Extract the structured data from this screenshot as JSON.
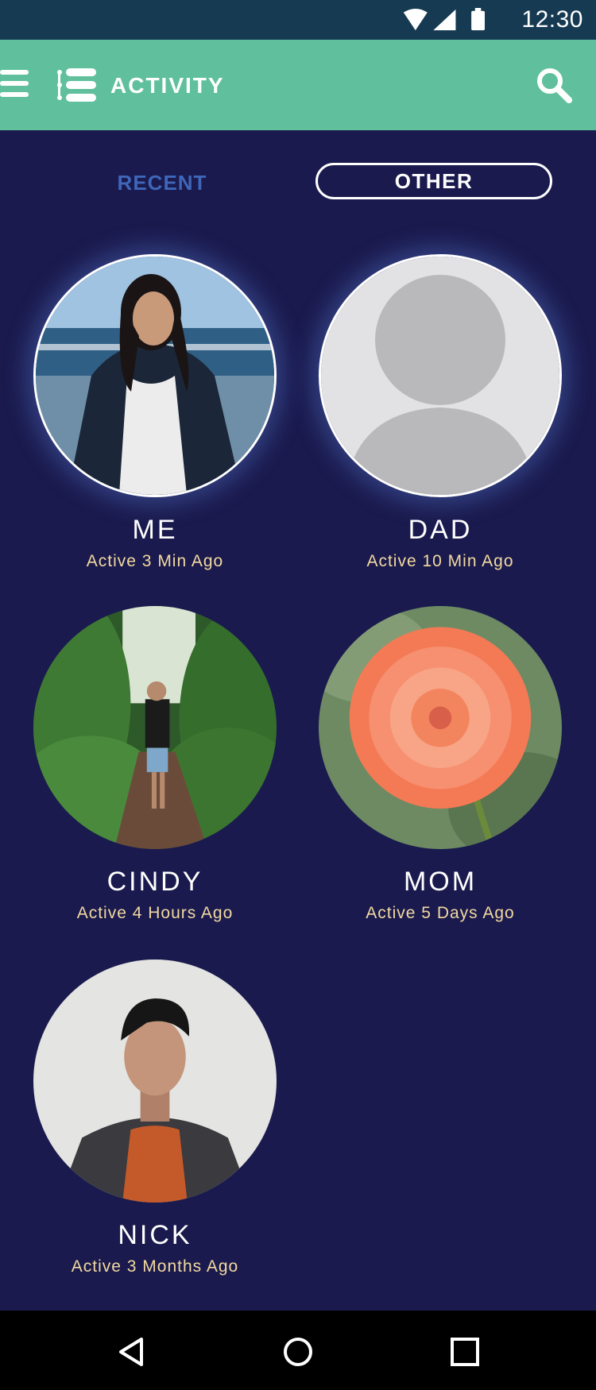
{
  "status_bar": {
    "time": "12:30",
    "icons": [
      "wifi-icon",
      "signal-icon",
      "battery-icon"
    ]
  },
  "app_bar": {
    "title": "ACTIVITY",
    "icons": [
      "menu-icon",
      "list-icon",
      "search-icon"
    ],
    "color": "#60c09d"
  },
  "tabs": [
    {
      "label": "RECENT",
      "selected": false
    },
    {
      "label": "OTHER",
      "selected": true
    }
  ],
  "contacts": [
    {
      "name": "ME",
      "status": "Active 3 Min Ago"
    },
    {
      "name": "DAD",
      "status": "Active 10 Min Ago"
    },
    {
      "name": "CINDY",
      "status": "Active 4 Hours Ago"
    },
    {
      "name": "MOM",
      "status": "Active 5 Days Ago"
    },
    {
      "name": "NICK",
      "status": "Active 3 Months Ago"
    }
  ],
  "nav_bar": {
    "icons": [
      "back-icon",
      "home-icon",
      "recents-icon"
    ]
  },
  "colors": {
    "background": "#1a1a4e",
    "status_bar": "#163a52",
    "accent": "#60c09d",
    "status_text": "#f2d9a0",
    "recent_tab": "#3f66b8"
  }
}
